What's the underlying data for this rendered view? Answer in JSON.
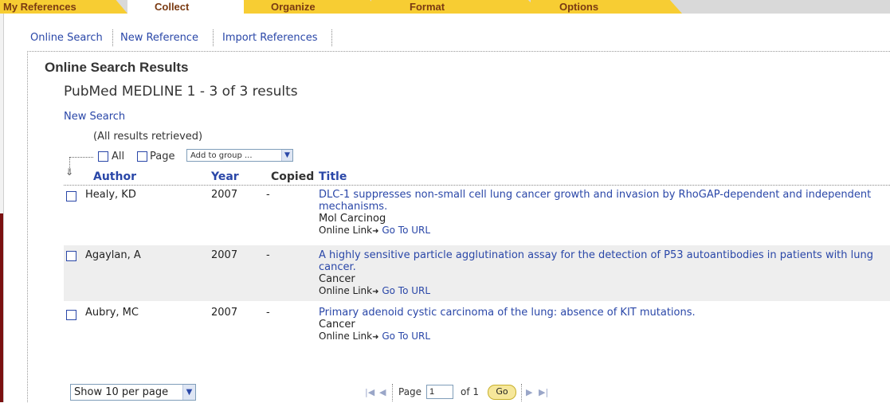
{
  "tabs": [
    {
      "label": "My References"
    },
    {
      "label": "Collect"
    },
    {
      "label": "Organize"
    },
    {
      "label": "Format"
    },
    {
      "label": "Options"
    }
  ],
  "subnav": {
    "online_search": "Online Search",
    "new_reference": "New Reference",
    "import_references": "Import References"
  },
  "page_title": "Online Search Results",
  "subtitle": "PubMed MEDLINE 1 - 3 of 3 results",
  "new_search": "New Search",
  "retrieved": "(All results retrieved)",
  "selection": {
    "all_label": "All",
    "page_label": "Page",
    "group_select": "Add to group ..."
  },
  "table": {
    "headers": {
      "author": "Author",
      "year": "Year",
      "copied": "Copied",
      "title": "Title"
    },
    "rows": [
      {
        "author": "Healy, KD",
        "year": "2007",
        "copied": "-",
        "title": "DLC-1 suppresses non-small cell lung cancer growth and invasion by RhoGAP-dependent and independent mechanisms.",
        "journal": "Mol Carcinog",
        "online_link": "Online Link",
        "go_to_url": "Go To URL"
      },
      {
        "author": "Agaylan, A",
        "year": "2007",
        "copied": "-",
        "title": "A highly sensitive particle agglutination assay for the detection of P53 autoantibodies in patients with lung cancer.",
        "journal": "Cancer",
        "online_link": "Online Link",
        "go_to_url": "Go To URL"
      },
      {
        "author": "Aubry, MC",
        "year": "2007",
        "copied": "-",
        "title": "Primary adenoid cystic carcinoma of the lung: absence of KIT mutations.",
        "journal": "Cancer",
        "online_link": "Online Link",
        "go_to_url": "Go To URL"
      }
    ]
  },
  "pagination": {
    "per_page": "Show 10 per page",
    "page_label": "Page",
    "page_value": "1",
    "of_label": "of 1",
    "go_label": "Go"
  },
  "colors": {
    "tab_yellow": "#f7cd33",
    "tab_text": "#7a3a12",
    "link_blue": "#2a47a8",
    "row_highlight": "#eeeeee"
  },
  "icons": [
    "dotted-down-arrow-icon",
    "first-page-icon",
    "prev-page-icon",
    "next-page-icon",
    "last-page-icon",
    "link-arrow-icon",
    "dropdown-arrow-icon"
  ]
}
